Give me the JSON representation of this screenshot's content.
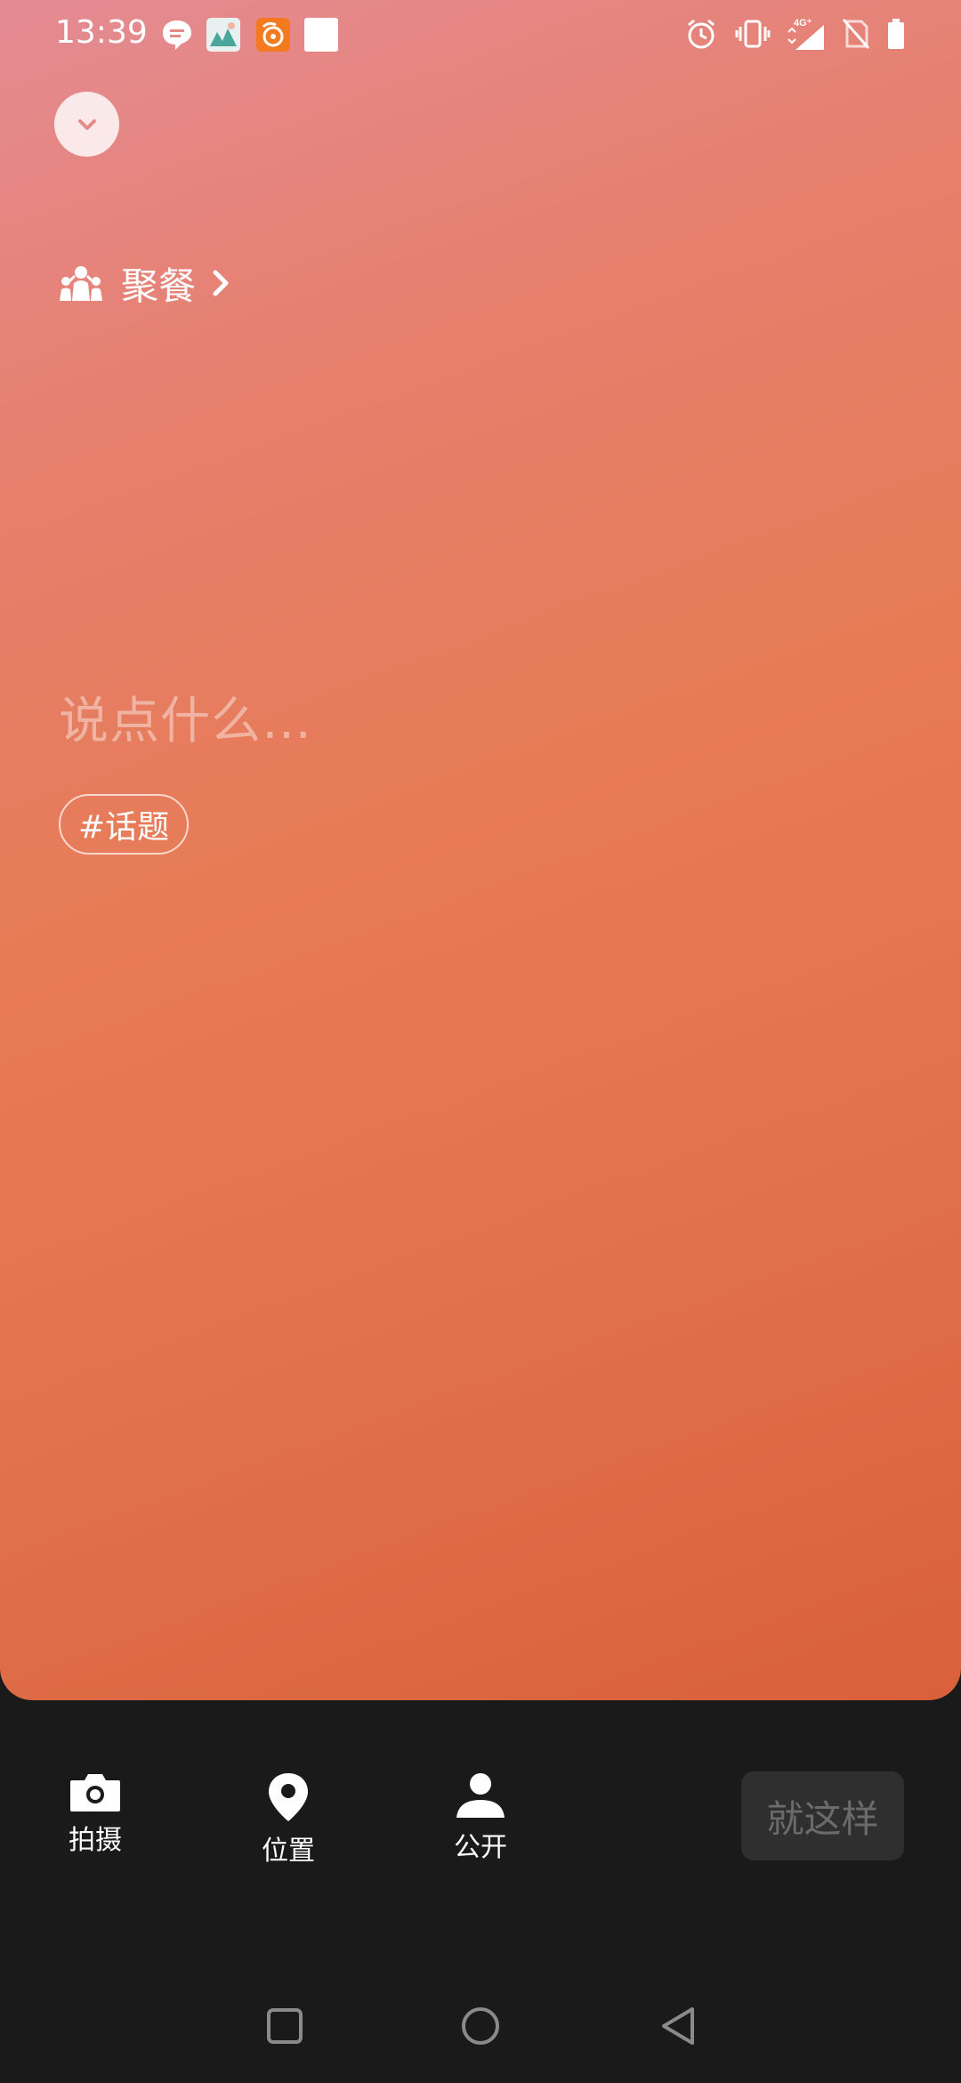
{
  "status_bar": {
    "time": "13:39",
    "network": "4G"
  },
  "header": {
    "collapse_icon": "chevron-down-icon"
  },
  "activity": {
    "icon": "people-icon",
    "label": "聚餐",
    "chevron_icon": "chevron-right-icon"
  },
  "compose": {
    "placeholder": "说点什么…"
  },
  "topic": {
    "label": "#话题"
  },
  "toolbar": {
    "shoot_label": "拍摄",
    "location_label": "位置",
    "visibility_label": "公开",
    "submit_label": "就这样"
  },
  "colors": {
    "gradient_top": "#e48b93",
    "gradient_bottom": "#d9603a",
    "background": "#1a1a1a",
    "submit_bg": "#2f2f2f"
  }
}
